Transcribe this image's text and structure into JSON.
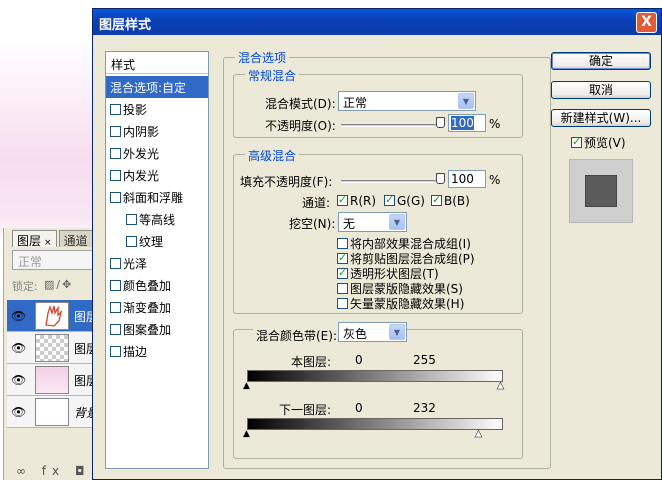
{
  "dialog": {
    "title": "图层样式",
    "close_label": "X"
  },
  "style_list": {
    "header": "样式",
    "items": [
      {
        "label": "混合选项:自定",
        "active": true,
        "checkbox": false,
        "indent": false
      },
      {
        "label": "投影",
        "active": false,
        "checkbox": true,
        "indent": false
      },
      {
        "label": "内阴影",
        "active": false,
        "checkbox": true,
        "indent": false
      },
      {
        "label": "外发光",
        "active": false,
        "checkbox": true,
        "indent": false
      },
      {
        "label": "内发光",
        "active": false,
        "checkbox": true,
        "indent": false
      },
      {
        "label": "斜面和浮雕",
        "active": false,
        "checkbox": true,
        "indent": false
      },
      {
        "label": "等高线",
        "active": false,
        "checkbox": true,
        "indent": true
      },
      {
        "label": "纹理",
        "active": false,
        "checkbox": true,
        "indent": true
      },
      {
        "label": "光泽",
        "active": false,
        "checkbox": true,
        "indent": false
      },
      {
        "label": "颜色叠加",
        "active": false,
        "checkbox": true,
        "indent": false
      },
      {
        "label": "渐变叠加",
        "active": false,
        "checkbox": true,
        "indent": false
      },
      {
        "label": "图案叠加",
        "active": false,
        "checkbox": true,
        "indent": false
      },
      {
        "label": "描边",
        "active": false,
        "checkbox": true,
        "indent": false
      }
    ]
  },
  "blend_options": {
    "title": "混合选项",
    "general": {
      "title": "常规混合",
      "mode_label": "混合模式(D):",
      "mode_value": "正常",
      "opacity_label": "不透明度(O):",
      "opacity_value": "100",
      "opacity_unit": "%",
      "opacity_level": 1.0
    },
    "advanced": {
      "title": "高级混合",
      "fill_label": "填充不透明度(F):",
      "fill_value": "100",
      "fill_unit": "%",
      "fill_level": 1.0,
      "channels_label": "通道:",
      "channel_r": "R(R)",
      "channel_g": "G(G)",
      "channel_b": "B(B)",
      "knockout_label": "挖空(N):",
      "knockout_value": "无",
      "options": [
        {
          "label": "将内部效果混合成组(I)",
          "checked": false
        },
        {
          "label": "将剪贴图层混合成组(P)",
          "checked": true
        },
        {
          "label": "透明形状图层(T)",
          "checked": true
        },
        {
          "label": "图层蒙版隐藏效果(S)",
          "checked": false
        },
        {
          "label": "矢量蒙版隐藏效果(H)",
          "checked": false
        }
      ]
    },
    "blend_if": {
      "label": "混合颜色带(E):",
      "value": "灰色",
      "this_layer_label": "本图层:",
      "this_layer_low": "0",
      "this_layer_high": "255",
      "underlying_label": "下一图层:",
      "underlying_low": "0",
      "underlying_high": "232"
    }
  },
  "buttons": {
    "ok": "确定",
    "cancel": "取消",
    "new_style": "新建样式(W)...",
    "preview_label": "预览(V)",
    "preview_checked": true
  },
  "layers_panel": {
    "tabs": [
      "图层",
      "通道"
    ],
    "tab_close": "×",
    "blend_mode": "正常",
    "lock_label": "锁定:",
    "layers": [
      {
        "name": "图层",
        "selected": true
      },
      {
        "name": "图层",
        "selected": false
      },
      {
        "name": "图层",
        "selected": false
      },
      {
        "name": "背景",
        "selected": false
      }
    ]
  },
  "colors": {
    "title_bar": "#0a46c8",
    "selection": "#3169c6",
    "group_title": "#0046d5",
    "close_button": "#e25a36"
  }
}
